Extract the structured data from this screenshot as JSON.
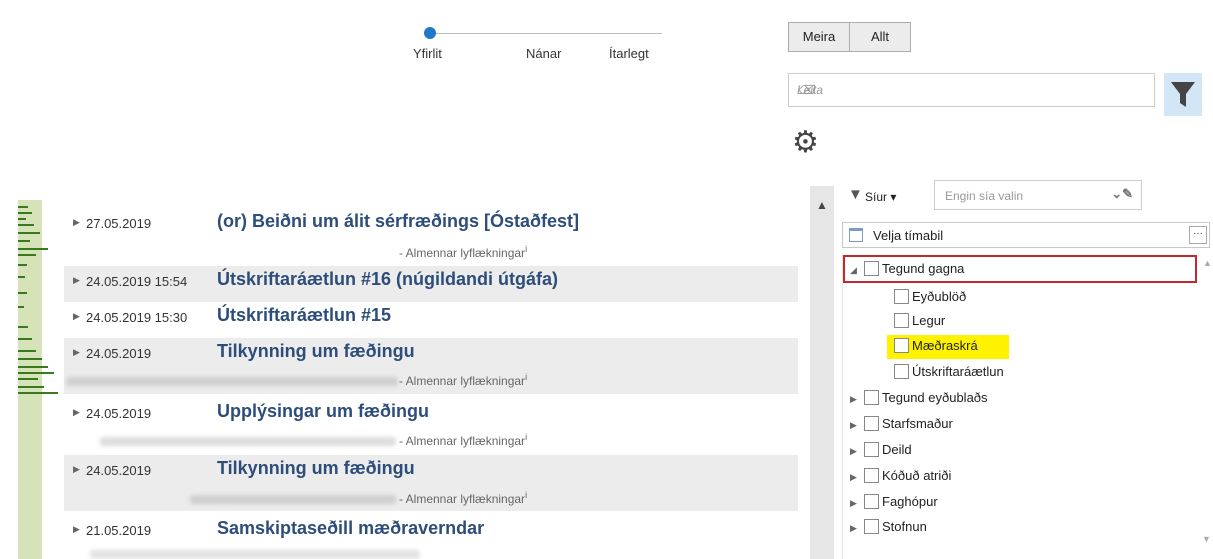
{
  "detail_slider": {
    "levels": [
      "Yfirlit",
      "Nánar",
      "Ítarlegt"
    ],
    "selected": "Yfirlit"
  },
  "list_items": [
    {
      "date": "27.05.2019",
      "title": "(or) Beiðni um álit sérfræðings [Óstaðfest]",
      "subtitle": "- Almennar lyflækningar",
      "info": "i"
    },
    {
      "date": "24.05.2019 15:54",
      "title": "Útskriftaráætlun #16 (núgildandi útgáfa)"
    },
    {
      "date": "24.05.2019 15:30",
      "title": "Útskriftaráætlun #15"
    },
    {
      "date": "24.05.2019",
      "title": "Tilkynning um fæðingu",
      "subtitle": "- Almennar lyflækningar",
      "info": "i"
    },
    {
      "date": "24.05.2019",
      "title": "Upplýsingar um fæðingu",
      "subtitle": "- Almennar lyflækningar",
      "info": "i"
    },
    {
      "date": "24.05.2019",
      "title": "Tilkynning um fæðingu",
      "subtitle": "- Almennar lyflækningar",
      "info": "i"
    },
    {
      "date": "21.05.2019",
      "title": "Samskiptaseðill mæðraverndar"
    }
  ],
  "buttons": {
    "more": "Meira",
    "all": "Allt"
  },
  "search": {
    "placeholder": "Leita"
  },
  "filters": {
    "label": "Síur",
    "placeholder": "Engin sía valin"
  },
  "period": {
    "label": "Velja tímabil",
    "more": "···"
  },
  "tree": {
    "root": "Tegund gagna",
    "children": [
      "Eyðublöð",
      "Legur",
      "Mæðraskrá",
      "Útskriftaráætlun"
    ],
    "highlighted": "Mæðraskrá",
    "others": [
      "Tegund eyðublaðs",
      "Starfsmaður",
      "Deild",
      "Kóðuð atriði",
      "Faghópur",
      "Stofnun"
    ]
  },
  "icons": [
    "caret-right-icon",
    "scroll-up-icon",
    "filter-icon",
    "gear-icon",
    "calendar-icon",
    "pen-icon",
    "chevron-down-icon"
  ],
  "colors": {
    "title": "#2d4d7a",
    "accent": "#1e7ac8",
    "highlight_border": "#c0282d",
    "highlight_fill": "#fff200",
    "strip": "#d6e3b9"
  }
}
